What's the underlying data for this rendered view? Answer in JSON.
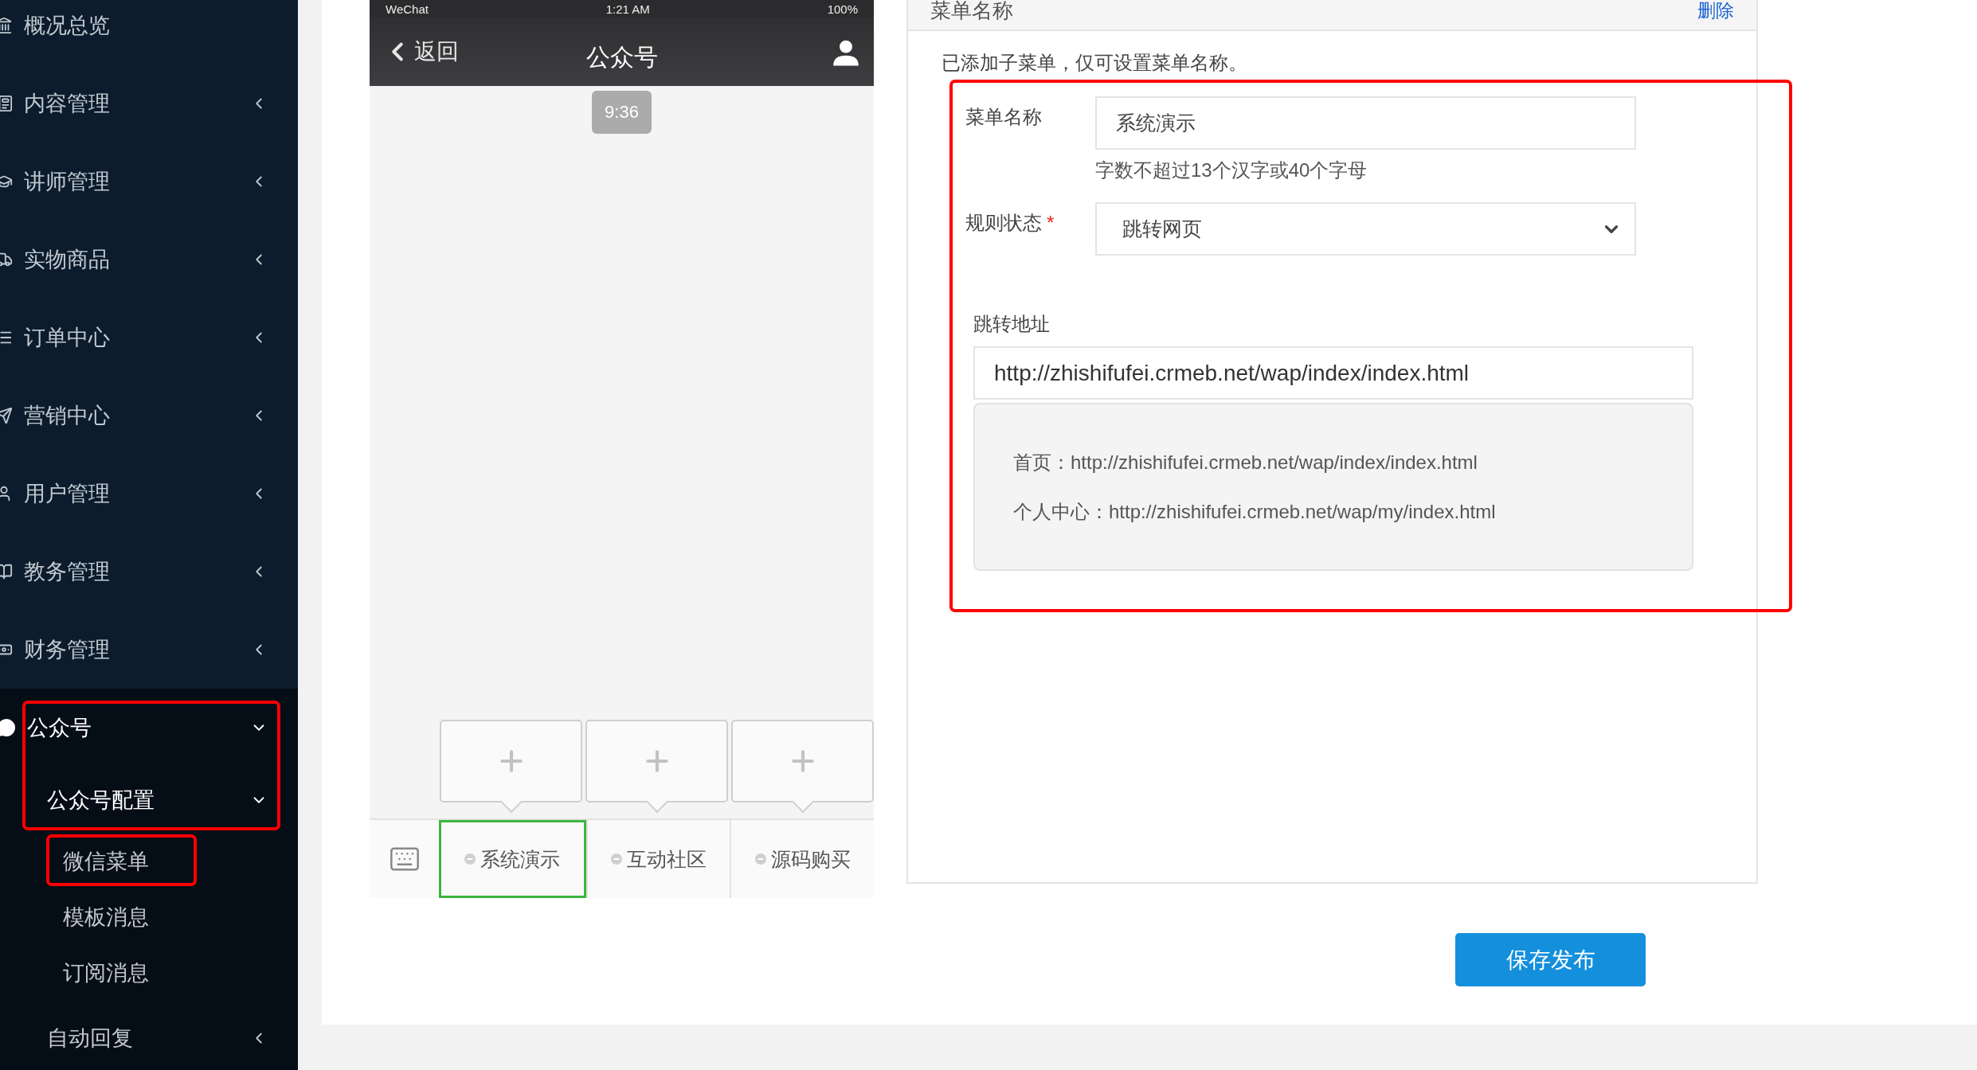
{
  "sidebar": {
    "items": [
      {
        "label": "概况总览",
        "kind": "link"
      },
      {
        "label": "内容管理",
        "kind": "group",
        "expanded": false
      },
      {
        "label": "讲师管理",
        "kind": "group",
        "expanded": false
      },
      {
        "label": "实物商品",
        "kind": "group",
        "expanded": false
      },
      {
        "label": "订单中心",
        "kind": "group",
        "expanded": false
      },
      {
        "label": "营销中心",
        "kind": "group",
        "expanded": false
      },
      {
        "label": "用户管理",
        "kind": "group",
        "expanded": false
      },
      {
        "label": "教务管理",
        "kind": "group",
        "expanded": false
      },
      {
        "label": "财务管理",
        "kind": "group",
        "expanded": false
      },
      {
        "label": "公众号",
        "kind": "group",
        "expanded": true,
        "children": [
          {
            "label": "公众号配置",
            "kind": "group",
            "expanded": true,
            "children": [
              {
                "label": "微信菜单",
                "kind": "link"
              },
              {
                "label": "模板消息",
                "kind": "link"
              },
              {
                "label": "订阅消息",
                "kind": "link"
              }
            ]
          },
          {
            "label": "自动回复",
            "kind": "group",
            "expanded": false
          }
        ]
      }
    ]
  },
  "phone": {
    "status_bar": {
      "carrier": "WeChat",
      "time": "1:21 AM",
      "battery": "100%"
    },
    "nav": {
      "back": "返回",
      "title": "公众号"
    },
    "timestamp": "9:36",
    "menu": [
      {
        "label": "系统演示",
        "selected": true
      },
      {
        "label": "互动社区",
        "selected": false
      },
      {
        "label": "源码购买",
        "selected": false
      }
    ]
  },
  "panel": {
    "title": "菜单名称",
    "delete_link": "删除",
    "notice": "已添加子菜单，仅可设置菜单名称。",
    "name_field": {
      "label": "菜单名称",
      "value": "系统演示",
      "hint": "字数不超过13个汉字或40个字母"
    },
    "rule_field": {
      "label": "规则状态",
      "required_mark": "*",
      "value": "跳转网页"
    },
    "url_field": {
      "label": "跳转地址",
      "value": "http://zhishifufei.crmeb.net/wap/index/index.html"
    },
    "url_hints": [
      {
        "label": "首页：",
        "url": "http://zhishifufei.crmeb.net/wap/index/index.html"
      },
      {
        "label": "个人中心：",
        "url": "http://zhishifufei.crmeb.net/wap/my/index.html"
      }
    ]
  },
  "save_button": "保存发布"
}
